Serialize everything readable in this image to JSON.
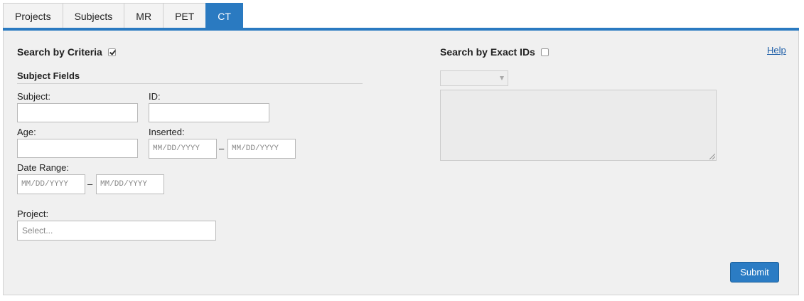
{
  "tabs": [
    {
      "label": "Projects",
      "active": false
    },
    {
      "label": "Subjects",
      "active": false
    },
    {
      "label": "MR",
      "active": false
    },
    {
      "label": "PET",
      "active": false
    },
    {
      "label": "CT",
      "active": true
    }
  ],
  "criteria": {
    "title": "Search by Criteria",
    "checked": true,
    "subject_fields_title": "Subject Fields",
    "subject_label": "Subject:",
    "subject_value": "",
    "id_label": "ID:",
    "id_value": "",
    "age_label": "Age:",
    "age_value": "",
    "inserted_label": "Inserted:",
    "inserted_from_placeholder": "MM/DD/YYYY",
    "inserted_to_placeholder": "MM/DD/YYYY",
    "date_range_label": "Date Range:",
    "date_from_placeholder": "MM/DD/YYYY",
    "date_to_placeholder": "MM/DD/YYYY",
    "range_separator": "–",
    "project_label": "Project:",
    "project_placeholder": "Select..."
  },
  "exact_ids": {
    "title": "Search by Exact IDs",
    "checked": false,
    "type_select_value": "",
    "ids_text": ""
  },
  "help_label": "Help",
  "submit_label": "Submit",
  "colors": {
    "accent": "#2a7ac1",
    "panel_bg": "#f0f0f0",
    "link": "#1f5fa8"
  }
}
